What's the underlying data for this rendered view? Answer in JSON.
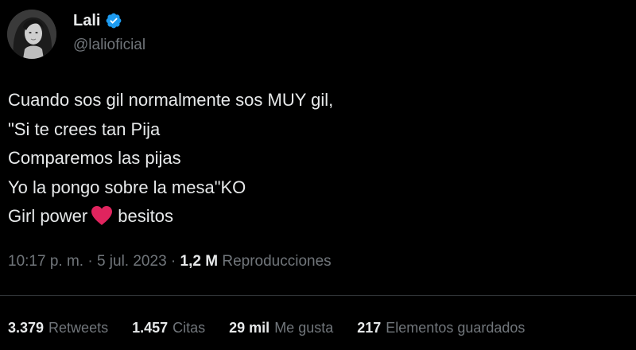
{
  "author": {
    "display_name": "Lali",
    "handle": "@lalioficial",
    "verified": true
  },
  "tweet": {
    "lines": [
      "Cuando sos gil normalmente sos MUY gil,",
      "\"Si te crees tan Pija",
      "Comparemos las pijas",
      "Yo la pongo sobre la mesa\"KO"
    ],
    "last_line_before_icon": "Girl power",
    "last_line_after_icon": "besitos",
    "emoji_icon": "red-heart-icon"
  },
  "meta": {
    "time": "10:17 p. m.",
    "separator": "·",
    "date": "5 jul. 2023",
    "views_count": "1,2 M",
    "views_label": "Reproducciones"
  },
  "stats": {
    "retweets_count": "3.379",
    "retweets_label": "Retweets",
    "quotes_count": "1.457",
    "quotes_label": "Citas",
    "likes_count": "29 mil",
    "likes_label": "Me gusta",
    "bookmarks_count": "217",
    "bookmarks_label": "Elementos guardados"
  },
  "colors": {
    "background": "#000000",
    "primary_text": "#e7e9ea",
    "secondary_text": "#71767b",
    "verified_badge": "#1d9bf0",
    "heart": "#e0245e",
    "divider": "#2f3336"
  }
}
